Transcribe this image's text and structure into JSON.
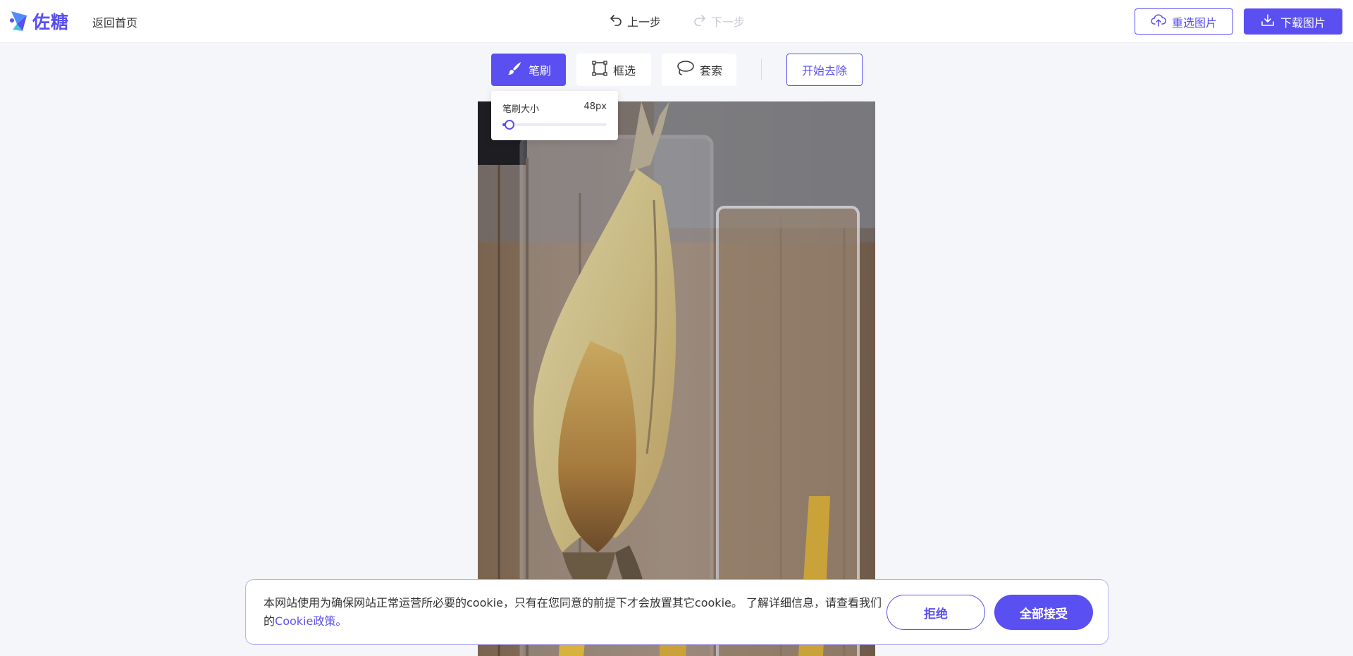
{
  "header": {
    "logo_text": "佐糖",
    "back_home": "返回首页",
    "undo_label": "上一步",
    "redo_label": "下一步",
    "reselect_label": "重选图片",
    "download_label": "下载图片"
  },
  "toolbar": {
    "brush_label": "笔刷",
    "rect_label": "框选",
    "lasso_label": "套索",
    "start_label": "开始去除",
    "active_tool": "brush"
  },
  "brush_size": {
    "label": "笔刷大小",
    "value_text": "48px",
    "slider_fraction": 0.07
  },
  "cookie": {
    "text": "本网站使用为确保网站正常运营所必要的cookie，只有在您同意的前提下才会放置其它cookie。 了解详细信息，请查看我们的",
    "link_text": "Cookie政策。",
    "reject_label": "拒绝",
    "accept_label": "全部接受"
  },
  "colors": {
    "accent": "#5a4ff0",
    "background": "#f5f6fa",
    "disabled": "#c8cad2"
  },
  "icons": {
    "logo": "zuotang-logo-icon",
    "undo": "undo-arrow-icon",
    "redo": "redo-arrow-icon",
    "reselect": "cloud-upload-icon",
    "download": "download-icon",
    "brush": "brush-icon",
    "rect": "rect-select-icon",
    "lasso": "lasso-icon"
  }
}
